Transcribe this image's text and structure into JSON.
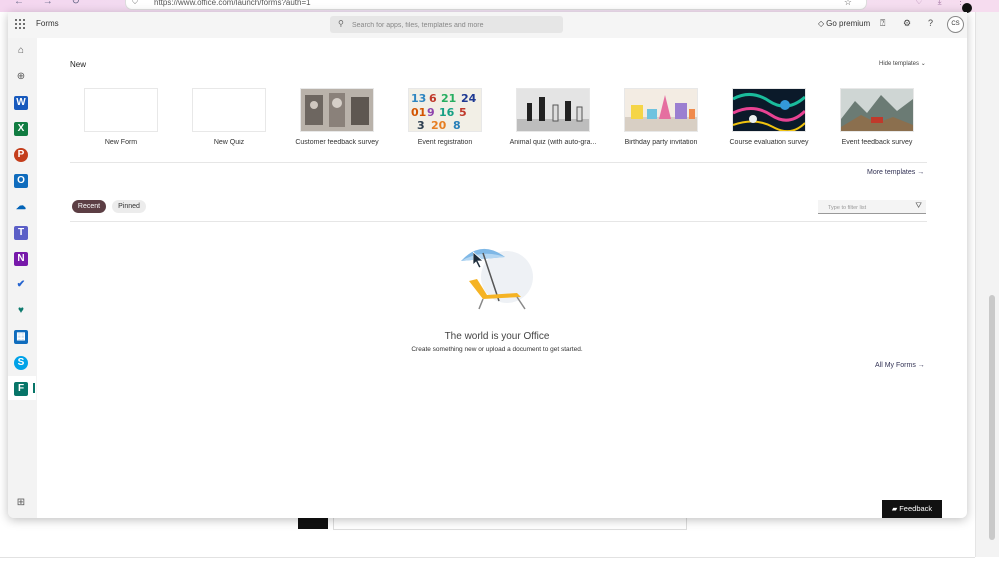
{
  "browser": {
    "url": "https://www.office.com/launch/forms?auth=1",
    "nav_glyphs": "← → ↻",
    "lock_glyph": "⛉",
    "star_glyph": "☆",
    "extension_glyphs": "♡ ⤓ ⋮"
  },
  "topbar": {
    "waffle_glyph": "⋮⋮⋮",
    "app_name": "Forms",
    "search_placeholder": "Search for apps, files, templates and more",
    "premium_label": "Go premium",
    "avatar_initials": "CS"
  },
  "sidebar": {
    "items": [
      {
        "name": "home",
        "glyph": "⌂"
      },
      {
        "name": "create",
        "glyph": "⊕"
      },
      {
        "name": "word",
        "glyph": "W",
        "color": "#185abd"
      },
      {
        "name": "excel",
        "glyph": "X",
        "color": "#107c41"
      },
      {
        "name": "powerpoint",
        "glyph": "P",
        "color": "#c43e1c"
      },
      {
        "name": "outlook",
        "glyph": "O",
        "color": "#0f6cbd"
      },
      {
        "name": "onedrive",
        "glyph": "☁",
        "color": "#0364b8"
      },
      {
        "name": "teams",
        "glyph": "T",
        "color": "#5b5fc7"
      },
      {
        "name": "onenote",
        "glyph": "N",
        "color": "#7719aa"
      },
      {
        "name": "todo",
        "glyph": "✔",
        "color": "#2564cf"
      },
      {
        "name": "family-safety",
        "glyph": "♥",
        "color": "#0d7a6e"
      },
      {
        "name": "calendar",
        "glyph": "▦",
        "color": "#0f6cbd"
      },
      {
        "name": "skype",
        "glyph": "S",
        "color": "#00a2e8"
      },
      {
        "name": "forms",
        "glyph": "F",
        "color": "#077568"
      }
    ],
    "apps_glyph": "⊞"
  },
  "new_section": {
    "heading": "New",
    "hide_templates": "Hide templates",
    "hide_chevron": "⌄",
    "templates": [
      {
        "caption": "New Form"
      },
      {
        "caption": "New Quiz"
      },
      {
        "caption": "Customer feedback survey"
      },
      {
        "caption": "Event registration"
      },
      {
        "caption": "Animal quiz (with auto-gra..."
      },
      {
        "caption": "Birthday party invitation"
      },
      {
        "caption": "Course evaluation survey"
      },
      {
        "caption": "Event feedback survey"
      }
    ],
    "more_templates": "More templates",
    "arrow_glyph": "→"
  },
  "recent_section": {
    "tab_recent": "Recent",
    "tab_pinned": "Pinned",
    "filter_placeholder": "Type to filter list",
    "funnel_glyph": "⛛",
    "empty_title": "The world is your Office",
    "empty_subtitle": "Create something new or upload a document to get started.",
    "all_my_forms": "All My Forms"
  },
  "feedback": {
    "label": "Feedback",
    "icon_glyph": "▰"
  },
  "colors": {
    "accent_tab": "#5c3e44",
    "forms_brand": "#077568"
  }
}
